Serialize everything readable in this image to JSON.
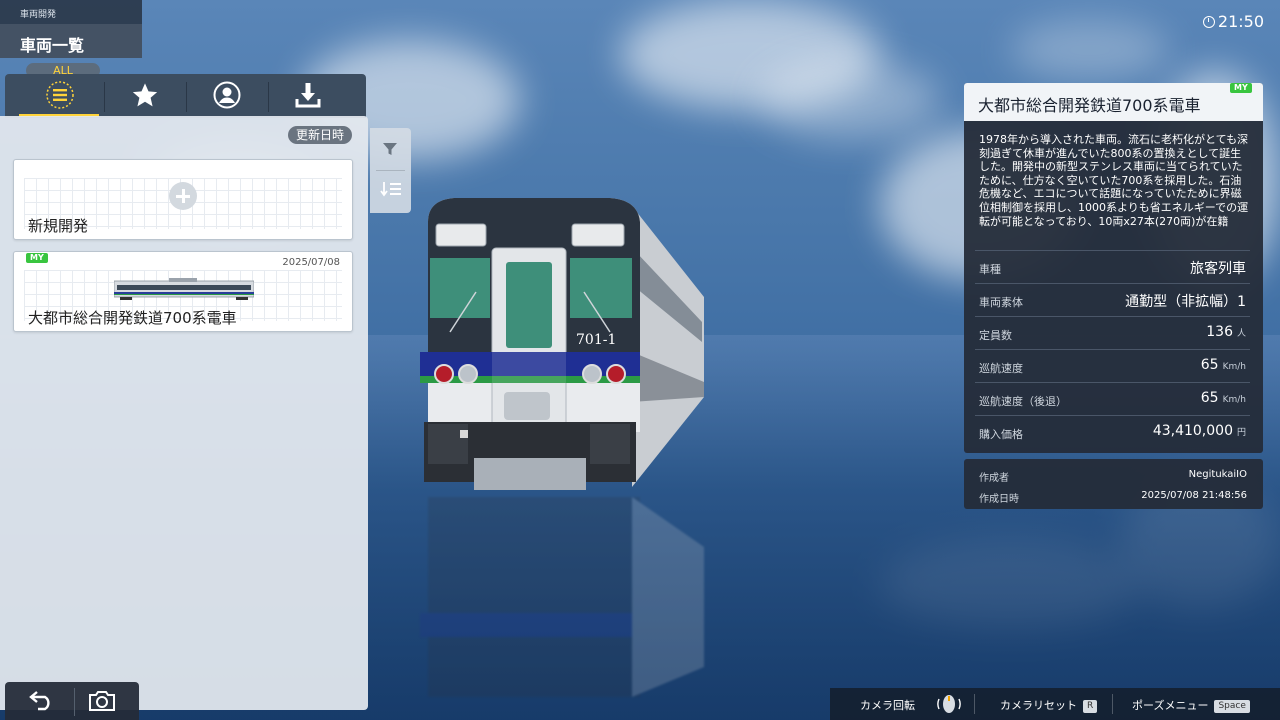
{
  "header": {
    "subtitle": "車両開発",
    "title": "車両一覧"
  },
  "clock": {
    "time": "21:50"
  },
  "tabs": {
    "all_label": "ALL",
    "items": [
      {
        "icon": "list-icon",
        "active": true
      },
      {
        "icon": "star-icon",
        "active": false
      },
      {
        "icon": "user-icon",
        "active": false
      },
      {
        "icon": "download-icon",
        "active": false
      }
    ]
  },
  "list": {
    "sort_label": "更新日時",
    "new_card": {
      "label": "新規開発"
    },
    "items": [
      {
        "badge": "MY",
        "date": "2025/07/08",
        "name": "大都市総合開発鉄道700系電車"
      }
    ]
  },
  "train": {
    "number": "701-1"
  },
  "info": {
    "badge": "MY",
    "title": "大都市総合開発鉄道700系電車",
    "description": "1978年から導入された車両。流石に老朽化がとても深刻過ぎて休車が進んでいた800系の置換えとして誕生した。開発中の新型ステンレス車両に当てられていたために、仕方なく空いていた700系を採用した。石油危機など、エコについて話題になっていたために界磁位相制御を採用し、1000系よりも省エネルギーでの運転が可能となっており、10両x27本(270両)が在籍",
    "specs": [
      {
        "label": "車種",
        "value": "旅客列車",
        "unit": ""
      },
      {
        "label": "車両素体",
        "value": "通勤型（非拡幅）1",
        "unit": ""
      },
      {
        "label": "定員数",
        "value": "136",
        "unit": "人"
      },
      {
        "label": "巡航速度",
        "value": "65",
        "unit": "Km/h"
      },
      {
        "label": "巡航速度（後退）",
        "value": "65",
        "unit": "Km/h"
      },
      {
        "label": "購入価格",
        "value": "43,410,000",
        "unit": "円"
      }
    ]
  },
  "creator": {
    "author_label": "作成者",
    "author": "NegitukaiIO",
    "date_label": "作成日時",
    "date": "2025/07/08 21:48:56"
  },
  "hints": {
    "camera_rotate": "カメラ回転",
    "camera_reset": "カメラリセット",
    "camera_reset_key": "R",
    "pause_menu": "ポーズメニュー",
    "pause_key": "Space"
  }
}
